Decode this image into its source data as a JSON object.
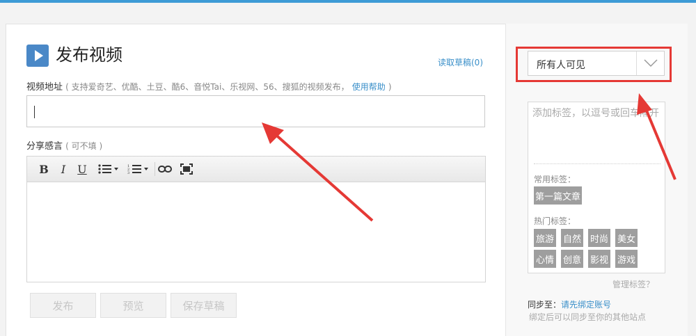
{
  "header": {
    "title": "发布视频",
    "draft_link": "读取草稿(0)"
  },
  "video_url": {
    "label": "视频地址",
    "hint": "( 支持爱奇艺、优酷、土豆、酷6、音悦Tai、乐视网、56、搜狐的视频发布，",
    "help_link": "使用帮助",
    "hint_end": " )",
    "value": ""
  },
  "comment": {
    "label": "分享感言",
    "hint": "( 可不填 )",
    "value": ""
  },
  "toolbar": {
    "bold": "B",
    "italic": "I",
    "underline": "U"
  },
  "actions": {
    "publish": "发布",
    "preview": "预览",
    "save_draft": "保存草稿"
  },
  "visibility": {
    "selected": "所有人可见"
  },
  "tags": {
    "placeholder": "添加标签，以逗号或回车隔开",
    "common_label": "常用标签：",
    "common": [
      "第一篇文章"
    ],
    "hot_label": "热门标签：",
    "hot": [
      "旅游",
      "自然",
      "时尚",
      "美女",
      "心情",
      "创意",
      "影视",
      "游戏"
    ]
  },
  "manage_tags": "管理标签？",
  "sync": {
    "label": "同步至：",
    "link": "请先绑定账号",
    "note": "绑定后可以同步至你的其他站点"
  },
  "colors": {
    "accent": "#3a8fc9",
    "highlight": "#e53935",
    "tag_bg": "#9e9e9e"
  }
}
